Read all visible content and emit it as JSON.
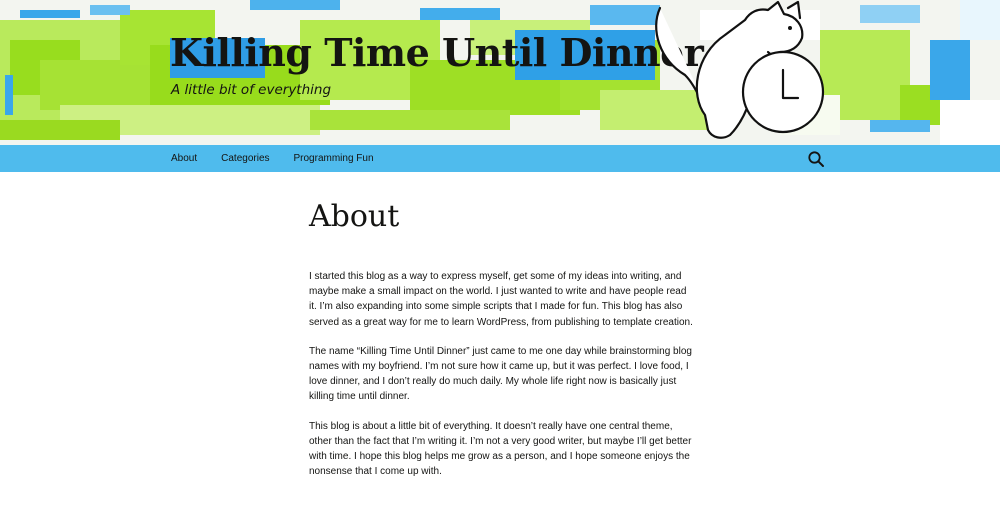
{
  "header": {
    "title": "Killing Time Until Dinner",
    "tagline": "A little bit of everything"
  },
  "nav": {
    "items": [
      {
        "label": "About"
      },
      {
        "label": "Categories"
      },
      {
        "label": "Programming Fun"
      }
    ],
    "search_icon": "search-icon"
  },
  "colors": {
    "nav_bg": "#4fbbed",
    "banner_green": "#9be21f",
    "banner_blue": "#3aa7ea",
    "text": "#141412"
  },
  "page": {
    "title": "About",
    "paragraphs": [
      "I started this blog as a way to express myself, get some of my ideas into writing, and maybe make a small impact on the world. I just wanted to write and have people read it. I’m also expanding into some simple scripts that I made for fun. This blog has also served as a great way for me to learn WordPress, from publishing to template creation.",
      "The name “Killing Time Until Dinner” just came to me one day while brainstorming blog names with my boyfriend. I’m not sure how it came up, but it was perfect. I love food, I love dinner, and I don’t really do much daily. My whole life right now is basically just killing time until dinner.",
      "This blog is about a little bit of everything. It doesn’t really have one central theme, other than the fact that I’m writing it. I’m not a very good writer, but maybe I’ll get better with time. I hope this blog helps me grow as a person, and I hope someone enjoys the nonsense that I come up with."
    ]
  }
}
